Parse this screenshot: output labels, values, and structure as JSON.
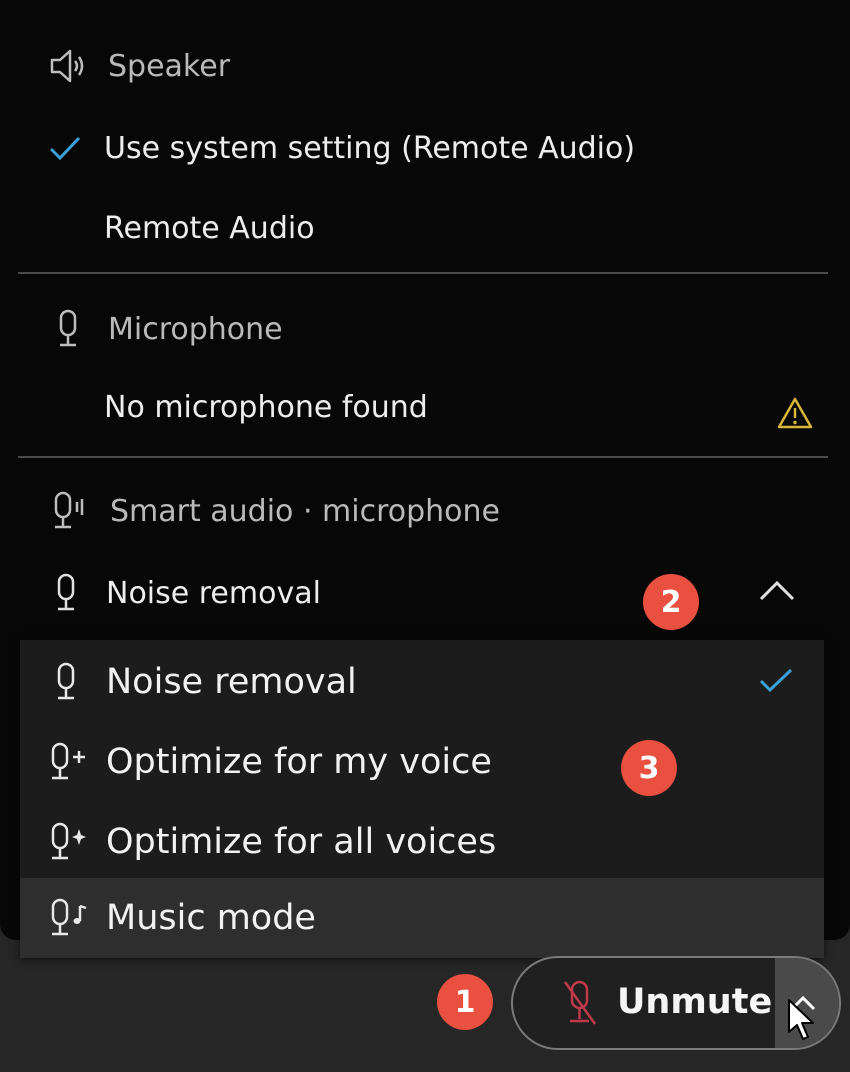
{
  "speaker": {
    "header": "Speaker",
    "options": [
      {
        "label": "Use system setting (Remote Audio)",
        "selected": true
      },
      {
        "label": "Remote Audio",
        "selected": false
      }
    ]
  },
  "microphone": {
    "header": "Microphone",
    "status": "No microphone found",
    "status_icon": "warning-icon"
  },
  "smart_audio": {
    "header": "Smart audio · microphone",
    "current": "Noise removal",
    "toggle_icon": "chevron-up-icon"
  },
  "dropdown": {
    "items": [
      {
        "label": "Noise removal",
        "icon": "microphone-icon",
        "selected": true
      },
      {
        "label": "Optimize for my voice",
        "icon": "microphone-plus-icon",
        "selected": false
      },
      {
        "label": "Optimize for all voices",
        "icon": "microphone-sparkle-icon",
        "selected": false
      },
      {
        "label": "Music mode",
        "icon": "microphone-music-icon",
        "selected": false,
        "hovered": true
      }
    ]
  },
  "badges": [
    "1",
    "2",
    "3"
  ],
  "unmute_button": {
    "label": "Unmute",
    "icon": "muted-microphone-icon"
  },
  "colors": {
    "accent_check": "#3aa0d8",
    "badge": "#e9503f",
    "warning": "#d8b73a",
    "muted_icon": "#c0394b"
  }
}
